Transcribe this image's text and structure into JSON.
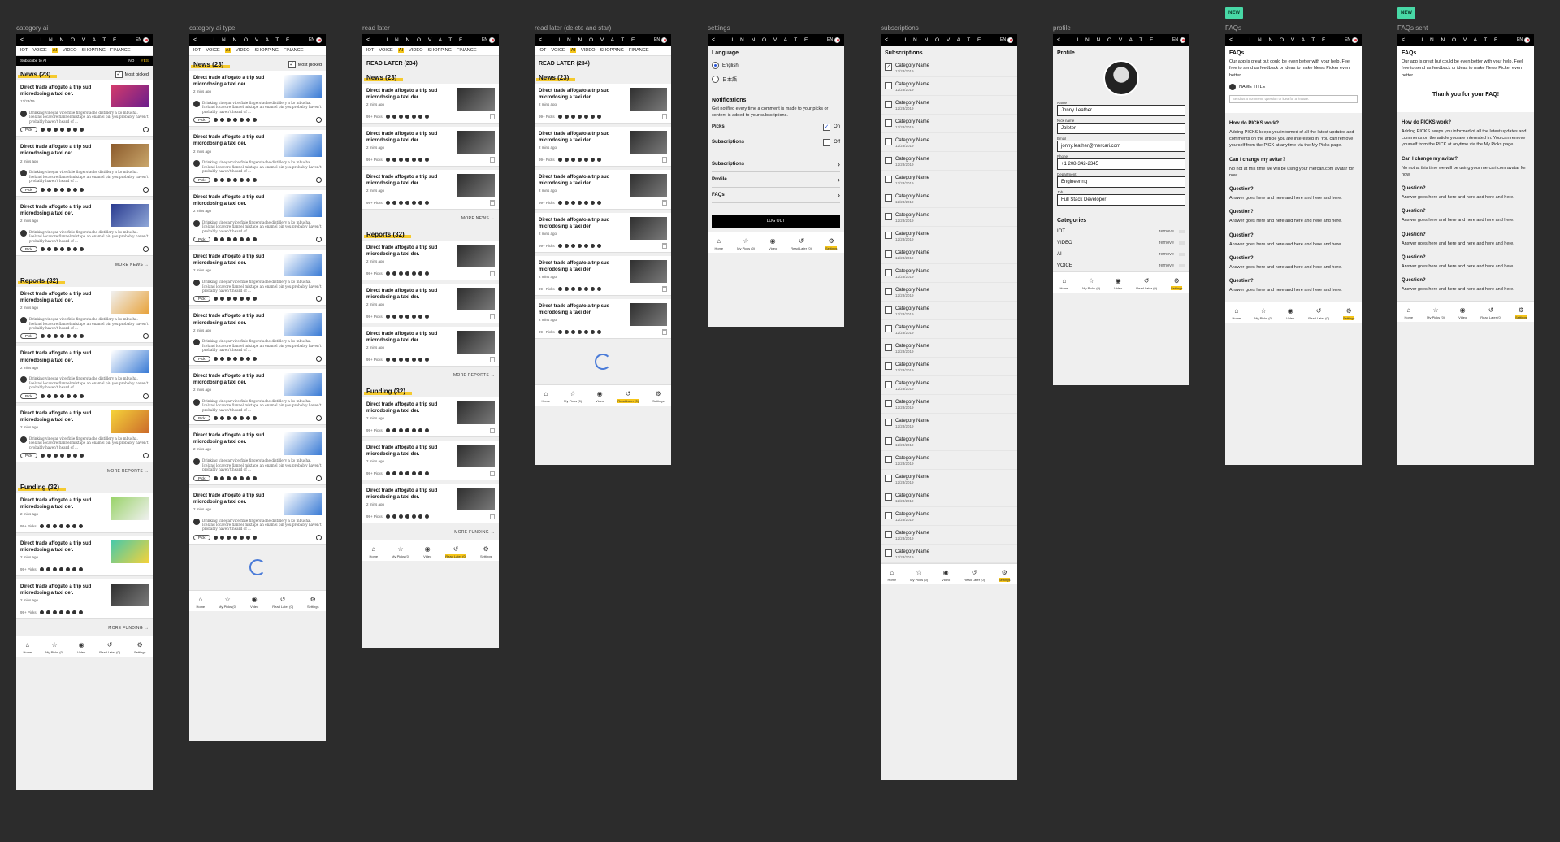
{
  "frames": {
    "category_ai": "category ai",
    "category_ai_type": "category ai type",
    "read_later": "read later",
    "read_later_ds": "read later (delete and star)",
    "settings": "settings",
    "subscriptions": "subscriptions",
    "profile": "profile",
    "faqs": "FAQs",
    "faqs_sent": "FAQs sent"
  },
  "badge_new": "NEW",
  "brand": {
    "logo": "I N N O V A T E",
    "lang": "EN",
    "back": "<"
  },
  "tabs": [
    "IOT",
    "VOICE",
    "AI",
    "VIDEO",
    "SHOPPING",
    "FINANCE"
  ],
  "subscribe": {
    "label": "Subscribe to AI",
    "no": "NO",
    "yes": "YES"
  },
  "sections": {
    "news": "News (23)",
    "reports": "Reports (32)",
    "funding": "Funding (32)",
    "more_news": "MORE NEWS →",
    "more_reports": "MORE REPORTS →",
    "more_funding": "MORE FUNDING →"
  },
  "most_picked": "Most picked",
  "article": {
    "title": "Direct trade affogato a trip sud microdosing a taxi der.",
    "date": "12/23/19",
    "time": "2 mins ago",
    "comment": "Drinking vinegar vice fixie fingerstache distillery a ko mbucha. Iceland locavore flannel mixtape an enamel pin you probably haven't probably haven't heard of ...",
    "pick": "Pick",
    "picks_count": "99+ Picks"
  },
  "read_later_title": "READ LATER (234)",
  "nav": {
    "home": "Home",
    "mypicks": "My Picks (0)",
    "video": "Video",
    "readlater": "Read Later (0)",
    "settings": "Settings"
  },
  "settings": {
    "language": "Language",
    "english": "English",
    "japanese": "日本語",
    "notifications": "Notifications",
    "notif_text": "Get notified every time a comment is made to your picks or content is added to your subscriptions.",
    "picks": "Picks",
    "on": "On",
    "subscriptions": "Subscriptions",
    "off": "Off",
    "link_subs": "Subscriptions",
    "link_profile": "Profile",
    "link_faqs": "FAQs",
    "logout": "LOG OUT"
  },
  "subscriptions": {
    "title": "Subscriptions",
    "item": "Category Name",
    "date": "12/23/2019"
  },
  "profile": {
    "title": "Profile",
    "name_label": "Name",
    "name": "Jonny Leather",
    "nick_label": "Nick name",
    "nick": "Joleter",
    "email_label": "Email",
    "email": "jonny.leather@mercari.com",
    "phone_label": "Phone",
    "phone": "+1 208-342-2345",
    "dept_label": "Department",
    "dept": "Engineering",
    "job_label": "Job",
    "job": "Full Stack Developer",
    "categories": "Categories",
    "cat_iot": "IOT",
    "cat_video": "VIDEO",
    "cat_ai": "AI",
    "cat_voice": "VOICE",
    "remove": "remove"
  },
  "faqs": {
    "title": "FAQs",
    "intro": "Our app is great but could be even better with your help. Feel free to send us feedback or ideas to make News Picker even better.",
    "name_title": "NAME TITLE",
    "placeholder": "Send us a comment, question or idea for a feature.",
    "thanks": "Thank you for your FAQ!",
    "q1": "How do PICKS work?",
    "a1": "Adding PICKS keeps you informed of all the latest updates and comments on the article you are interested in. You can remove yourself from the PICK at anytime via the My Picks page.",
    "q2": "Can I change my avitar?",
    "a2": "No not at this time we will be using your mercari.com avatar for now.",
    "q": "Question?",
    "a": "Answer goes here and here and here and here and here."
  },
  "colors": {
    "accent": "#f5c518",
    "badge": "#48d8a6",
    "bg": "#2c2c2c"
  }
}
